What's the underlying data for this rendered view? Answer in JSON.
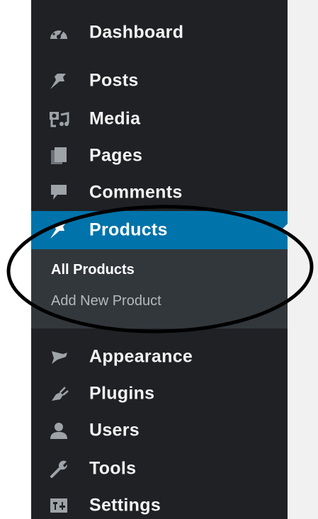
{
  "sidebar": {
    "items": [
      {
        "label": "Dashboard",
        "icon": "dashboard-icon"
      },
      {
        "label": "Posts",
        "icon": "pushpin-icon"
      },
      {
        "label": "Media",
        "icon": "media-icon"
      },
      {
        "label": "Pages",
        "icon": "pages-icon"
      },
      {
        "label": "Comments",
        "icon": "comment-icon"
      },
      {
        "label": "Products",
        "icon": "pushpin-icon",
        "active": true
      },
      {
        "label": "Appearance",
        "icon": "paintbrush-icon"
      },
      {
        "label": "Plugins",
        "icon": "plugin-icon"
      },
      {
        "label": "Users",
        "icon": "users-icon"
      },
      {
        "label": "Tools",
        "icon": "wrench-icon"
      },
      {
        "label": "Settings",
        "icon": "settings-icon"
      }
    ],
    "submenu": [
      {
        "label": "All Products",
        "current": true
      },
      {
        "label": "Add New Product",
        "current": false
      }
    ]
  },
  "colors": {
    "sidebar_bg": "#1f2124",
    "submenu_bg": "#32373c",
    "active_bg": "#0073aa",
    "text": "#f3f3f3",
    "submenu_text": "#b4b9be",
    "icon": "#9ea3a8",
    "annotation": "#000000"
  },
  "annotation": {
    "shape": "ellipse",
    "target": "Products submenu"
  }
}
